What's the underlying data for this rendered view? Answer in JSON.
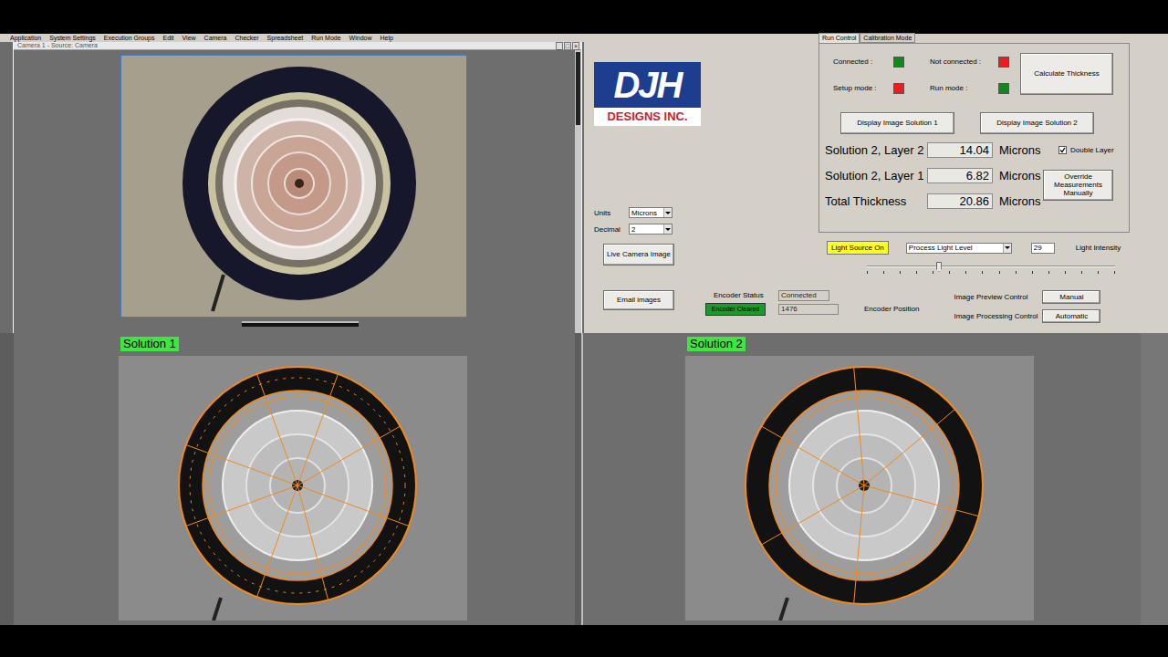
{
  "menu": [
    "Application",
    "System Settings",
    "Execution Groups",
    "Edit",
    "View",
    "Camera",
    "Checker",
    "Spreadsheet",
    "Run Mode",
    "Window",
    "Help"
  ],
  "camera_window": {
    "title": "Camera 1 - Source: Camera",
    "controls": [
      "_",
      "□",
      "×"
    ]
  },
  "logo": {
    "mark": "DJH",
    "subtitle": "DESIGNS INC."
  },
  "tabs": [
    {
      "label": "Run Control",
      "selected": true
    },
    {
      "label": "Calibration Mode",
      "selected": false
    }
  ],
  "status": [
    {
      "label": "Connected :",
      "color": "#11891a"
    },
    {
      "label": "Not connected :",
      "color": "#ee1c1c"
    },
    {
      "label": "Setup mode :",
      "color": "#ee1c1c"
    },
    {
      "label": "Run mode :",
      "color": "#11891a"
    }
  ],
  "calculate_button": "Calculate Thickness",
  "display_buttons": [
    "Display Image Solution 1",
    "Display Image Solution 2"
  ],
  "measurements": [
    {
      "label": "Solution 2, Layer 2",
      "value": "14.04",
      "unit": "Microns"
    },
    {
      "label": "Solution 2, Layer 1",
      "value": "6.82",
      "unit": "Microns"
    },
    {
      "label": "Total Thickness",
      "value": "20.86",
      "unit": "Microns"
    }
  ],
  "double_layer": {
    "label": "Double Layer",
    "checked": true
  },
  "override_button": "Override Measurements Manually",
  "units": {
    "label": "Units",
    "value": "Microns"
  },
  "decimal": {
    "label": "Decimal",
    "value": "2"
  },
  "live_button": "Live Camera Image",
  "light": {
    "button": "Light Source On",
    "mode": "Process Light Level",
    "intensity": "29",
    "label": "Light Intensity",
    "level": 0.29
  },
  "email_button": "Email images",
  "encoder": {
    "status_label": "Encoder Status",
    "status": "Connected",
    "cleared_button": "Encoder Cleared",
    "position": "1476",
    "position_label": "Encoder Position"
  },
  "image_controls": [
    {
      "label": "Image Preview Control",
      "value": "Manual"
    },
    {
      "label": "Image Processing Control",
      "value": "Automatic"
    }
  ],
  "solutions": [
    {
      "label": "Solution 1"
    },
    {
      "label": "Solution 2"
    }
  ]
}
